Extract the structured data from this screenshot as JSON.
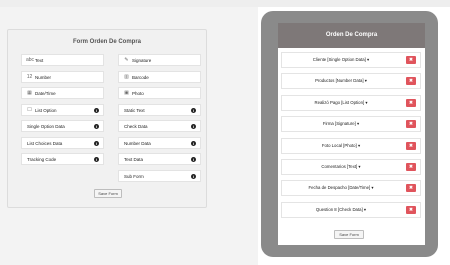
{
  "builder": {
    "title": "Form Orden De Compra",
    "left_fields": [
      {
        "label": "Text",
        "icon": "abc-icon",
        "glyph": "abc",
        "info": false
      },
      {
        "label": "Number",
        "icon": "number-icon",
        "glyph": "12",
        "info": false
      },
      {
        "label": "Date/Time",
        "icon": "calendar-icon",
        "glyph": "▦",
        "info": false
      },
      {
        "label": "List Option",
        "icon": "list-icon",
        "glyph": "☐",
        "info": true
      },
      {
        "label": "Single Option Data",
        "icon": "",
        "glyph": "",
        "info": true
      },
      {
        "label": "List Choices Data",
        "icon": "",
        "glyph": "",
        "info": true
      },
      {
        "label": "Tracking Code",
        "icon": "",
        "glyph": "",
        "info": true
      }
    ],
    "right_fields": [
      {
        "label": "Signature",
        "icon": "pen-icon",
        "glyph": "✎",
        "info": false
      },
      {
        "label": "Barcode",
        "icon": "barcode-icon",
        "glyph": "▥",
        "info": false
      },
      {
        "label": "Photo",
        "icon": "photo-icon",
        "glyph": "▣",
        "info": false
      },
      {
        "label": "Static Text",
        "icon": "",
        "glyph": "",
        "info": true
      },
      {
        "label": "Check Data",
        "icon": "",
        "glyph": "",
        "info": true
      },
      {
        "label": "Number Data",
        "icon": "",
        "glyph": "",
        "info": true
      },
      {
        "label": "Text Data",
        "icon": "",
        "glyph": "",
        "info": true
      },
      {
        "label": "Sub Form",
        "icon": "",
        "glyph": "",
        "info": true
      }
    ],
    "save_label": "Save Form"
  },
  "preview": {
    "title": "Orden De Compra",
    "fields": [
      {
        "label": "Cliente [Single Option Data] ▾"
      },
      {
        "label": "Productos [Number Data] ▾"
      },
      {
        "label": "Realizó Pago [List Option] ▾"
      },
      {
        "label": "Firma [Signature] ▾"
      },
      {
        "label": "Foto Local [Photo] ▾"
      },
      {
        "label": "Comentarios [Text] ▾"
      },
      {
        "label": "Fecha de Despacho [Date/Time] ▾"
      },
      {
        "label": "Question 8 [Check Data] ▾"
      }
    ],
    "delete_glyph": "✖",
    "save_label": "Save Form"
  }
}
